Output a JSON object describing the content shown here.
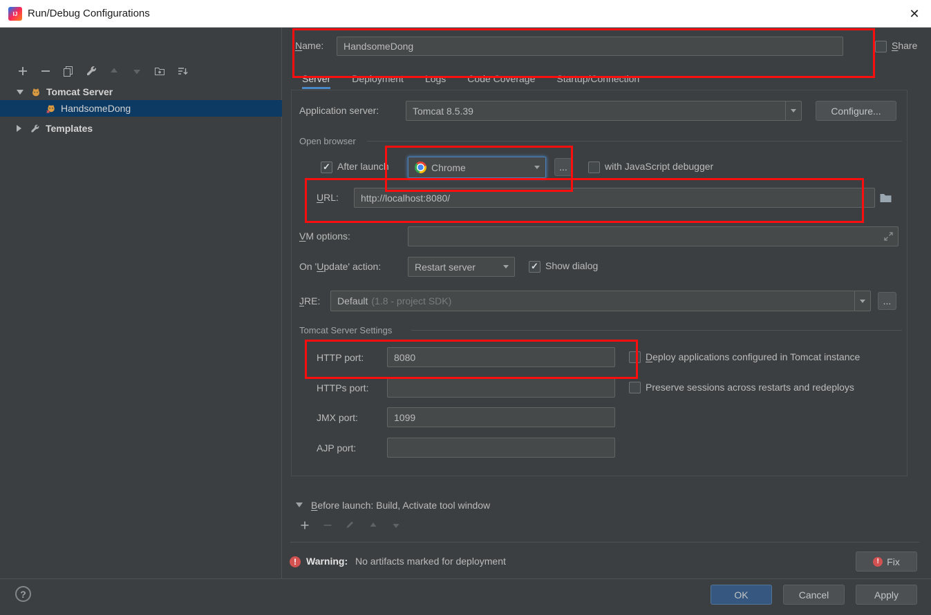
{
  "window": {
    "title": "Run/Debug Configurations",
    "close": "✕"
  },
  "colors": {
    "background": "#3c3f41",
    "field": "#45494a",
    "accent": "#4a88c7",
    "tree_selection": "#0d3a63",
    "annotation": "#fb0e0e",
    "error": "#d25252",
    "primary_button": "#365880",
    "titlebar": "#ffffff"
  },
  "sidebar": {
    "toolbar_icons": [
      "add",
      "remove",
      "copy",
      "edit-defaults",
      "move-up",
      "move-down",
      "new-folder",
      "sort"
    ],
    "tree": [
      {
        "label": "Tomcat Server",
        "expanded": true,
        "selected": false
      },
      {
        "label": "HandsomeDong",
        "expanded": false,
        "selected": true
      },
      {
        "label": "Templates",
        "expanded": false,
        "selected": false
      }
    ]
  },
  "main": {
    "name": {
      "label": "Name:",
      "value": "HandsomeDong"
    },
    "share": {
      "label": "Share",
      "checked": false
    },
    "tabs": [
      "Server",
      "Deployment",
      "Logs",
      "Code Coverage",
      "Startup/Connection"
    ],
    "selected_tab": "Server",
    "application_server": {
      "label": "Application server:",
      "value": "Tomcat 8.5.39",
      "configure": "Configure..."
    },
    "open_browser": {
      "group": "Open browser",
      "after_launch": "After launch",
      "after_launch_checked": true,
      "browser": "Chrome",
      "browse_more": "...",
      "js_debugger": "with JavaScript debugger",
      "js_debugger_checked": false,
      "url_label": "URL:",
      "url": "http://localhost:8080/"
    },
    "vm_options": {
      "label": "VM options:",
      "value": ""
    },
    "on_update": {
      "label": "On 'Update' action:",
      "value": "Restart server",
      "show_dialog": "Show dialog",
      "show_dialog_checked": true
    },
    "jre": {
      "label": "JRE:",
      "value": "Default",
      "hint": "(1.8 - project SDK)",
      "more": "..."
    },
    "tomcat_settings": {
      "group": "Tomcat Server Settings",
      "http_port": {
        "label": "HTTP port:",
        "value": "8080"
      },
      "https_port": {
        "label": "HTTPs port:",
        "value": ""
      },
      "jmx_port": {
        "label": "JMX port:",
        "value": "1099"
      },
      "ajp_port": {
        "label": "AJP port:",
        "value": ""
      },
      "deploy": "Deploy applications configured in Tomcat instance",
      "deploy_checked": false,
      "preserve": "Preserve sessions across restarts and redeploys",
      "preserve_checked": false
    },
    "before_launch": {
      "label": "Before launch: Build, Activate tool window",
      "toolbar_icons": [
        "add",
        "remove",
        "edit",
        "move-up",
        "move-down"
      ]
    },
    "warning": {
      "title": "Warning:",
      "message": "No artifacts marked for deployment",
      "fix": "Fix"
    }
  },
  "footer": {
    "ok": "OK",
    "cancel": "Cancel",
    "apply": "Apply",
    "help": "?"
  }
}
